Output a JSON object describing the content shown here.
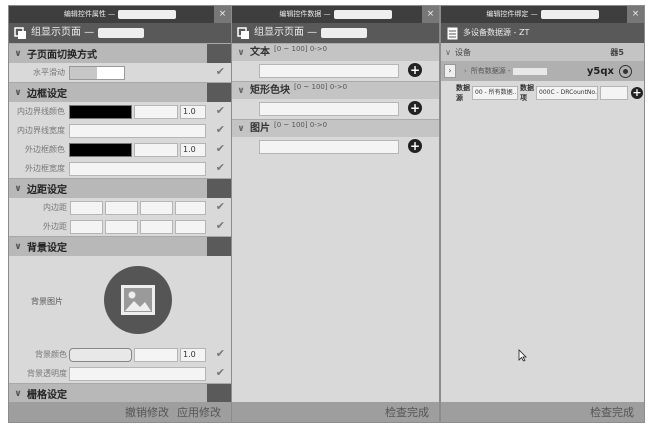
{
  "panel1": {
    "window_title": "编辑控件属性 —",
    "close_label": "×",
    "header_title": "组显示页面 —",
    "sections": {
      "page_switch": {
        "title": "子页面切换方式",
        "label": "水平滑动"
      },
      "border": {
        "title": "边框设定",
        "inner_color_label": "内边界线颜色",
        "inner_color_value": "1.0",
        "inner_width_label": "内边界线宽度",
        "outer_color_label": "外边框颜色",
        "outer_color_value": "1.0",
        "outer_width_label": "外边框宽度"
      },
      "margin": {
        "title": "边距设定",
        "inner_label": "内边距",
        "outer_label": "外边距"
      },
      "background": {
        "title": "背景设定",
        "image_label": "背景图片",
        "color_label": "背景颜色",
        "color_value": "1.0",
        "opacity_label": "背景透明度"
      },
      "grid": {
        "title": "栅格设定"
      }
    },
    "footer": {
      "cancel": "撤销修改",
      "apply": "应用修改"
    }
  },
  "panel2": {
    "window_title": "编辑控件数据 —",
    "close_label": "×",
    "header_title": "组显示页面 —",
    "sections": [
      {
        "title": "文本",
        "range": "[0 ~ 100] 0->0"
      },
      {
        "title": "矩形色块",
        "range": "[0 ~ 100] 0->0"
      },
      {
        "title": "图片",
        "range": "[0 ~ 100] 0->0"
      }
    ],
    "footer": {
      "done": "检查完成"
    }
  },
  "panel3": {
    "window_title": "编辑控件绑定 —",
    "close_label": "×",
    "header_title": "多设备数据源 - ZT",
    "device_label": "设备",
    "device_count": "器5",
    "row_text": "所有数据源 -",
    "row_code": "y5qx",
    "source_label": "数据源",
    "source_value": "00 - 所有数据...",
    "item_label": "数据项",
    "item_value": "000C - DRCountNo...",
    "footer": {
      "done": "检查完成"
    }
  }
}
